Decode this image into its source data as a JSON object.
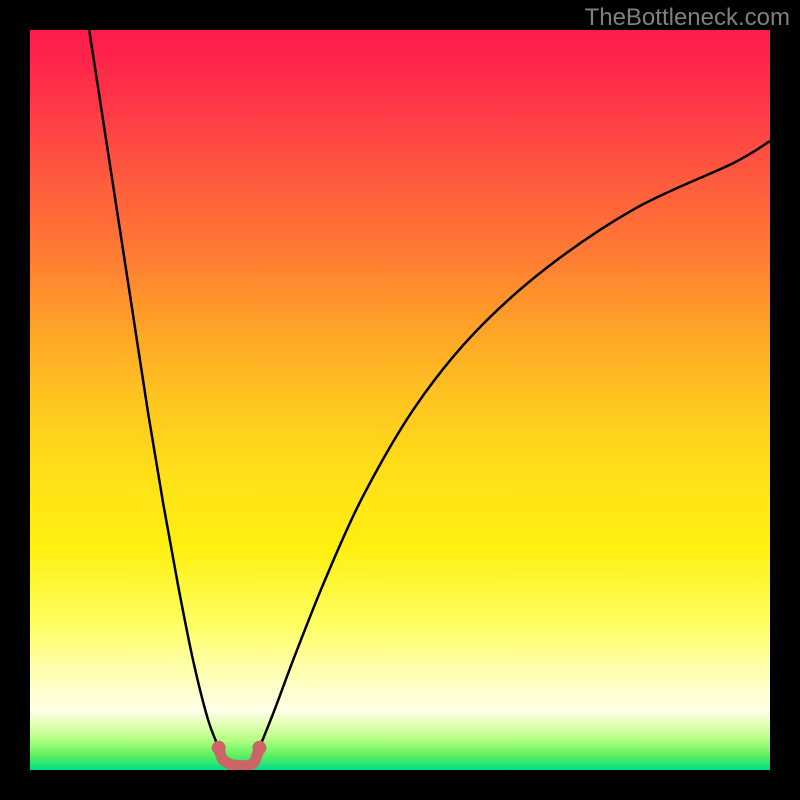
{
  "watermark": "TheBottleneck.com",
  "colors": {
    "background": "#000000",
    "curve": "#000000",
    "marker": "#cc6666",
    "gradient_top": "#ff1a4d",
    "gradient_bottom": "#00de88"
  },
  "chart_data": {
    "type": "line",
    "title": "",
    "xlabel": "",
    "ylabel": "",
    "xlim": [
      0,
      100
    ],
    "ylim": [
      0,
      100
    ],
    "series": [
      {
        "name": "left-branch",
        "x": [
          8,
          10,
          12,
          14,
          16,
          18,
          20,
          22,
          24,
          25.5
        ],
        "y": [
          100,
          87,
          74,
          61,
          48,
          36,
          25,
          15,
          7,
          3
        ]
      },
      {
        "name": "right-branch",
        "x": [
          31,
          33,
          36,
          40,
          45,
          52,
          60,
          70,
          82,
          95,
          100
        ],
        "y": [
          3,
          8,
          16,
          26,
          37,
          49,
          59,
          68,
          76,
          82,
          85
        ]
      },
      {
        "name": "valley-marker",
        "x": [
          25.5,
          26,
          27,
          28,
          29,
          30,
          30.5,
          31
        ],
        "y": [
          3,
          1.5,
          0.8,
          0.6,
          0.6,
          0.8,
          1.5,
          3
        ]
      }
    ],
    "grid": false,
    "legend": false,
    "annotations": []
  }
}
